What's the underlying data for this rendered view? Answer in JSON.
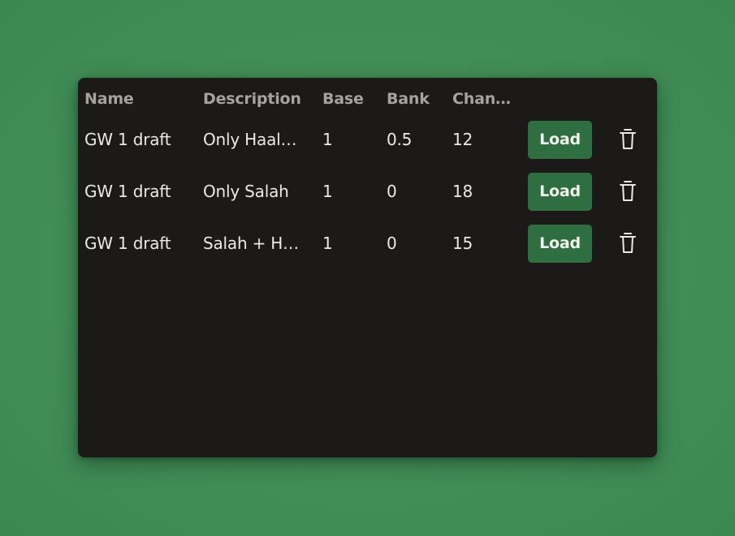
{
  "table": {
    "headers": [
      "Name",
      "Description",
      "Base",
      "Bank",
      "Chan…"
    ],
    "rows": [
      {
        "name": "GW 1 draft",
        "description": "Only Haal…",
        "base": "1",
        "bank": "0.5",
        "changes": "12",
        "load_label": "Load",
        "delete_icon": "trash-icon"
      },
      {
        "name": "GW 1 draft",
        "description": "Only Salah",
        "base": "1",
        "bank": "0",
        "changes": "18",
        "load_label": "Load",
        "delete_icon": "trash-icon"
      },
      {
        "name": "GW 1 draft",
        "description": "Salah + H…",
        "base": "1",
        "bank": "0",
        "changes": "15",
        "load_label": "Load",
        "delete_icon": "trash-icon"
      }
    ]
  },
  "colors": {
    "background": "#438f58",
    "panel": "#1b1a19",
    "header_text": "#a8a29e",
    "cell_text": "#eae9e6",
    "load_button": "#2f6e40"
  }
}
